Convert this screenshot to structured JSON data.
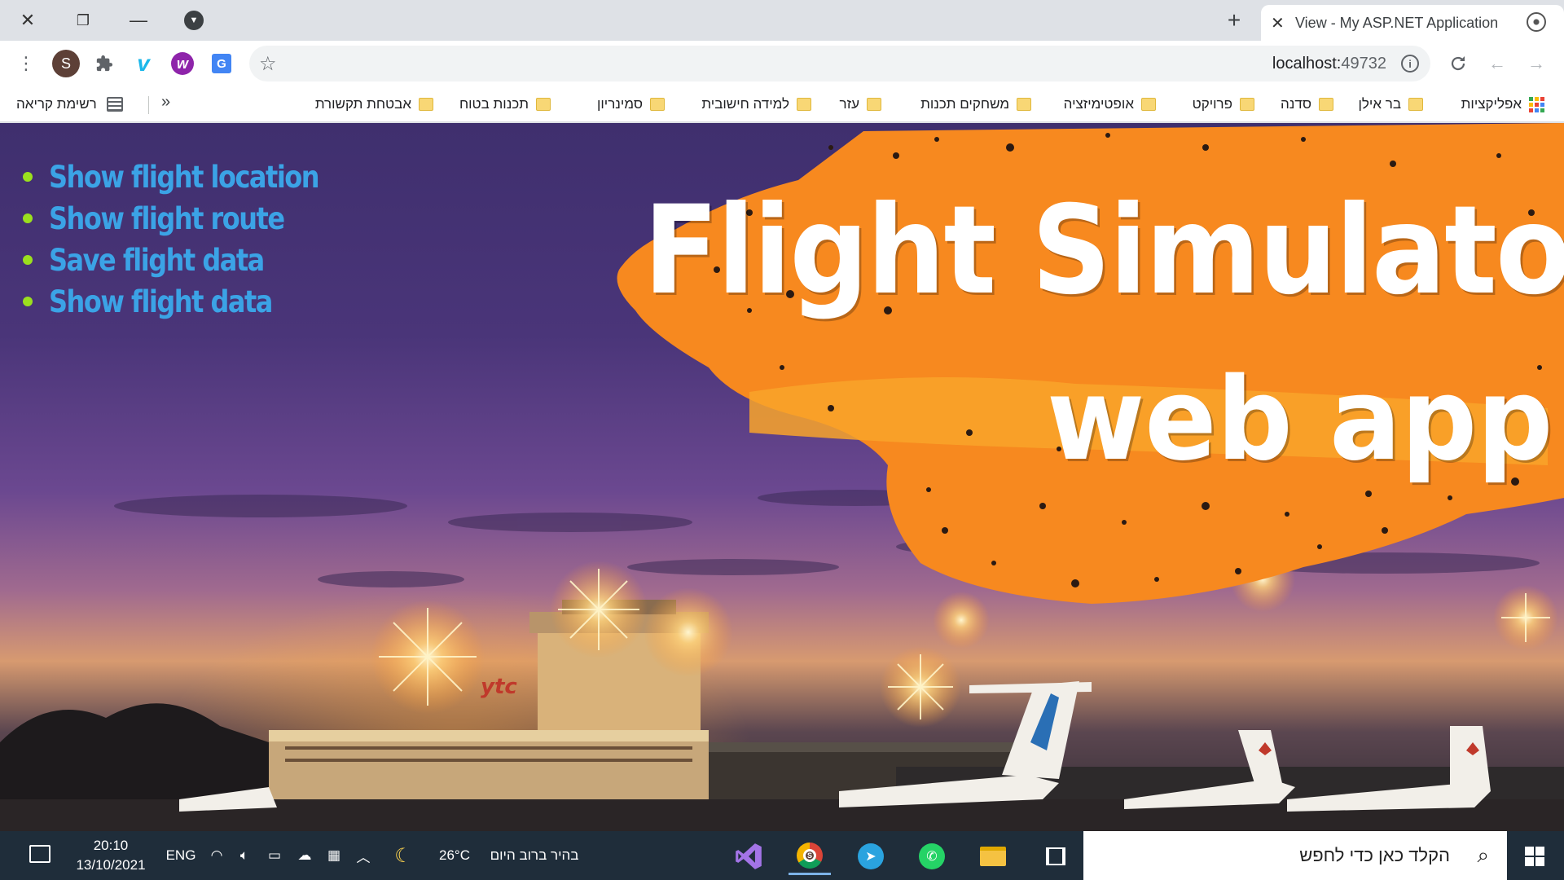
{
  "window": {
    "controls": {
      "close": "✕",
      "restore": "❐",
      "minimize": "—"
    },
    "new_tab": "+",
    "tab": {
      "close": "✕",
      "title": "View - My ASP.NET Application"
    }
  },
  "toolbar": {
    "avatar_letter": "S",
    "url_host": "localhost:",
    "url_port": "49732",
    "menu_icon": "⋮",
    "extensions_icon": "puzzle-icon",
    "vimeo_letter": "v",
    "w_letter": "w",
    "translate_letter": "G"
  },
  "bookmarks": {
    "reading_list": "רשימת קריאה",
    "overflow": "»",
    "items": [
      {
        "label": "אפליקציות"
      },
      {
        "label": "בר אילן"
      },
      {
        "label": "סדנה"
      },
      {
        "label": "פרויקט"
      },
      {
        "label": "אופטימיזציה"
      },
      {
        "label": "משחקים תכנות"
      },
      {
        "label": "עזר"
      },
      {
        "label": "למידה חישובית"
      },
      {
        "label": "סמינריון"
      },
      {
        "label": "תכנות בטוח"
      },
      {
        "label": "אבטחת תקשורת"
      }
    ]
  },
  "page": {
    "nav": [
      {
        "label": "Show flight location"
      },
      {
        "label": "Show flight route"
      },
      {
        "label": "Save flight data"
      },
      {
        "label": "Show flight data"
      }
    ],
    "hero_title": "Flight Simulator",
    "hero_subtitle": "web app",
    "tower_sign": "ytc"
  },
  "taskbar": {
    "search_placeholder": "הקלד כאן כדי לחפש",
    "weather": "בהיר ברוב היום",
    "temperature": "26°C",
    "language": "ENG",
    "time": "20:10",
    "date": "13/10/2021",
    "chrome_badge": "S"
  },
  "colors": {
    "nav_link": "#3ba3e6",
    "nav_bullet": "#9be01e",
    "hero_splash": "#f7891f",
    "taskbar": "#1f2d3a"
  }
}
